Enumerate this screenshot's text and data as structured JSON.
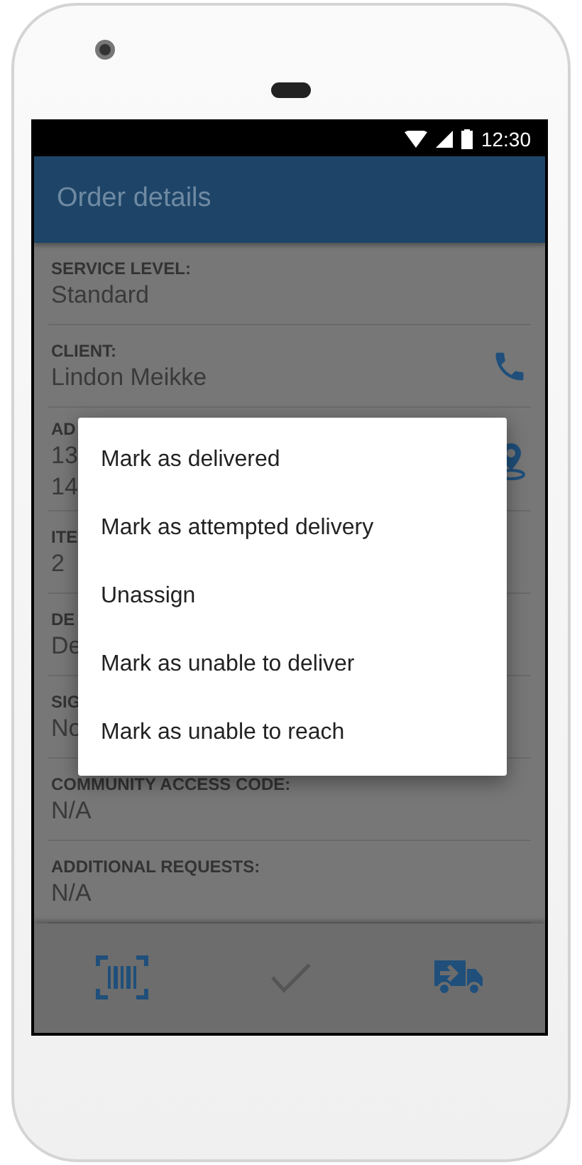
{
  "status_bar": {
    "time": "12:30"
  },
  "app_bar": {
    "title": "Order details"
  },
  "fields": [
    {
      "label": "SERVICE LEVEL:",
      "values": [
        "Standard"
      ]
    },
    {
      "label": "CLIENT:",
      "values": [
        "Lindon Meikke"
      ],
      "kind": "phone"
    },
    {
      "label": "AD",
      "values": [
        "13",
        "14"
      ],
      "kind": "map"
    },
    {
      "label": "ITE",
      "values": [
        "2"
      ]
    },
    {
      "label": "DE",
      "values": [
        "De"
      ]
    },
    {
      "label": "SIG",
      "values": [
        "No"
      ]
    },
    {
      "label": "COMMUNITY ACCESS CODE:",
      "values": [
        "N/A"
      ]
    },
    {
      "label": "ADDITIONAL REQUESTS:",
      "values": [
        "N/A"
      ]
    }
  ],
  "menu": {
    "items": [
      {
        "label": "Mark as delivered"
      },
      {
        "label": "Mark as attempted delivery"
      },
      {
        "label": "Unassign"
      },
      {
        "label": "Mark as unable to deliver"
      },
      {
        "label": "Mark as unable to reach"
      }
    ]
  },
  "bottom_bar": {
    "buttons": [
      {
        "kind": "barcode",
        "disabled": false
      },
      {
        "kind": "check",
        "disabled": true
      },
      {
        "kind": "truck",
        "disabled": false
      }
    ]
  }
}
